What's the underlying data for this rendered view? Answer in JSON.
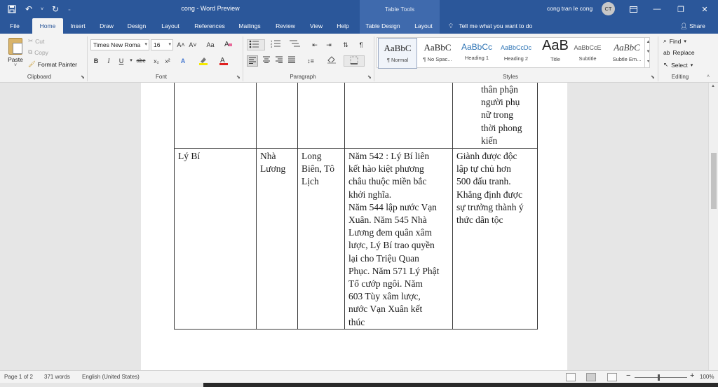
{
  "titlebar": {
    "title": "cong  -  Word Preview",
    "table_tools": "Table Tools",
    "user": "cong tran le cong",
    "avatar_initials": "CT"
  },
  "tabs": [
    {
      "label": "File"
    },
    {
      "label": "Home"
    },
    {
      "label": "Insert"
    },
    {
      "label": "Draw"
    },
    {
      "label": "Design"
    },
    {
      "label": "Layout"
    },
    {
      "label": "References"
    },
    {
      "label": "Mailings"
    },
    {
      "label": "Review"
    },
    {
      "label": "View"
    },
    {
      "label": "Help"
    },
    {
      "label": "Table Design"
    },
    {
      "label": "Layout"
    }
  ],
  "active_tab": "Home",
  "tell_me": "Tell me what you want to do",
  "share": "Share",
  "clipboard": {
    "paste": "Paste",
    "cut": "Cut",
    "copy": "Copy",
    "format_painter": "Format Painter",
    "group": "Clipboard"
  },
  "font": {
    "name": "Times New Roma",
    "size": "16",
    "grow": "A˄",
    "shrink": "A˅",
    "change_case": "Aa",
    "bold": "B",
    "italic": "I",
    "underline": "U",
    "strike": "abc",
    "subscript": "x₂",
    "superscript": "x²",
    "group": "Font"
  },
  "paragraph": {
    "group": "Paragraph"
  },
  "styles": {
    "group": "Styles",
    "items": [
      {
        "preview": "AaBbC",
        "name": "¶ Normal"
      },
      {
        "preview": "AaBbC",
        "name": "¶ No Spac..."
      },
      {
        "preview": "AaBbCc",
        "name": "Heading 1"
      },
      {
        "preview": "AaBbCcDc",
        "name": "Heading 2"
      },
      {
        "preview": "AaB",
        "name": "Title"
      },
      {
        "preview": "AaBbCcE",
        "name": "Subtitle"
      },
      {
        "preview": "AaBbC",
        "name": "Subtle Em..."
      }
    ]
  },
  "editing": {
    "find": "Find",
    "replace": "Replace",
    "select": "Select",
    "group": "Editing"
  },
  "document": {
    "row_top_last": [
      "thân phận",
      "người phụ",
      "nữ trong",
      "thời phong",
      "kiến"
    ],
    "row2": {
      "c1": "Lý Bí",
      "c2": [
        "Nhà",
        "Lương"
      ],
      "c3": [
        "Long",
        "Biên, Tô",
        "Lịch"
      ],
      "c4": [
        "Năm 542 : Lý Bí liên",
        "kết hào kiệt phương",
        "châu thuộc miền bắc",
        "khởi nghĩa.",
        "Năm 544 lập nước Vạn",
        "Xuân. Năm 545 Nhà",
        "Lương đem quân xâm",
        "lược, Lý Bí trao quyền",
        "lại cho Triệu Quan",
        "Phục. Năm 571 Lý Phật",
        "Tổ cướp ngôi. Năm",
        "603 Tùy xâm lược,",
        "nước Vạn Xuân kết",
        "thúc"
      ],
      "c5": [
        "Giành được độc",
        "lập tự chủ hơn",
        "500 đấu tranh.",
        "Khẳng định được",
        "sự trưởng thành ý",
        "thức dân tộc"
      ]
    }
  },
  "status": {
    "page": "Page 1 of 2",
    "words": "371 words",
    "language": "English (United States)",
    "zoom": "100%"
  }
}
